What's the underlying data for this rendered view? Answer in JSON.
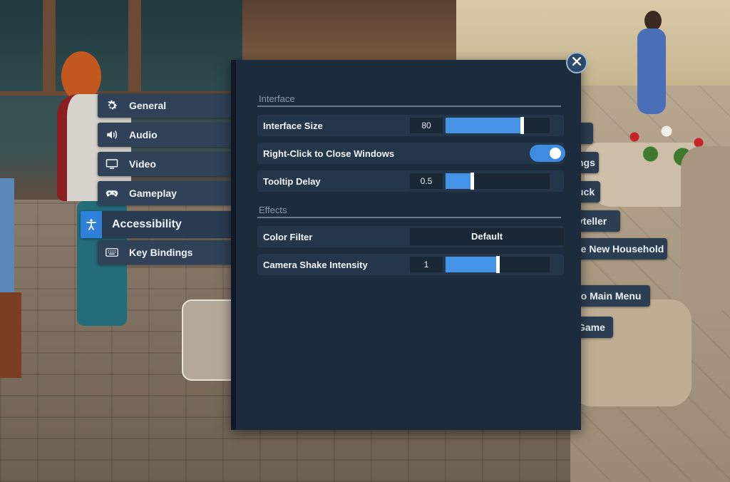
{
  "sidebar": {
    "tabs": [
      {
        "label": "General",
        "icon": "gear-icon"
      },
      {
        "label": "Audio",
        "icon": "speaker-icon"
      },
      {
        "label": "Video",
        "icon": "monitor-icon"
      },
      {
        "label": "Gameplay",
        "icon": "gamepad-icon"
      },
      {
        "label": "Accessibility",
        "icon": "accessibility-icon",
        "active": true
      },
      {
        "label": "Key Bindings",
        "icon": "keyboard-icon"
      }
    ]
  },
  "background_menu": {
    "items": [
      "ngs",
      "uck",
      "yteller",
      "te New Household",
      "to Main Menu",
      "Game"
    ]
  },
  "panel": {
    "sections": {
      "interface": {
        "title": "Interface",
        "interface_size": {
          "label": "Interface Size",
          "value": "80",
          "fraction": 0.73
        },
        "right_click_close": {
          "label": "Right-Click to Close Windows",
          "enabled": true
        },
        "tooltip_delay": {
          "label": "Tooltip Delay",
          "value": "0.5",
          "fraction": 0.25
        }
      },
      "effects": {
        "title": "Effects",
        "color_filter": {
          "label": "Color Filter",
          "value": "Default"
        },
        "camera_shake": {
          "label": "Camera Shake Intensity",
          "value": "1",
          "fraction": 0.5
        }
      }
    }
  },
  "colors": {
    "accent": "#4493e6",
    "panel_bg": "#1d2c3d",
    "active_tab_icon_bg": "#2f80d8"
  }
}
